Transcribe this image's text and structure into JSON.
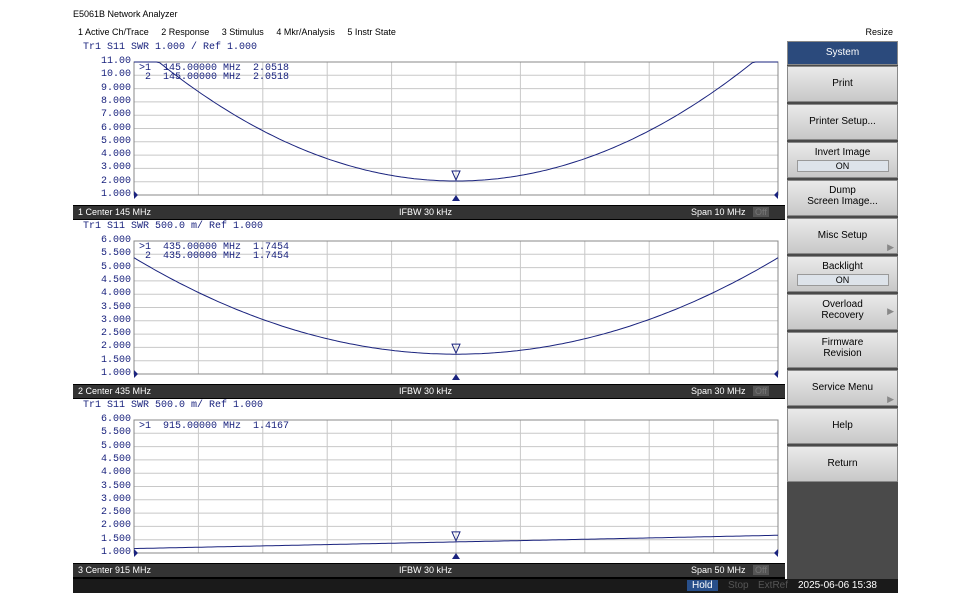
{
  "window": {
    "title": "E5061B Network Analyzer"
  },
  "menubar": {
    "items": [
      "1 Active Ch/Trace",
      "2 Response",
      "3 Stimulus",
      "4 Mkr/Analysis",
      "5 Instr State"
    ],
    "resize": "Resize"
  },
  "channels": [
    {
      "header": "Tr1 S11 SWR 1.000 / Ref 1.000",
      "trace_label": "Tr1",
      "yticks": [
        "11.00",
        "10.00",
        "9.000",
        "8.000",
        "7.000",
        "6.000",
        "5.000",
        "4.000",
        "3.000",
        "2.000",
        "1.000"
      ],
      "ymin": 1.0,
      "ymax": 11.0,
      "markers": [
        ">1  145.00000 MHz  2.0518",
        " 2  145.00000 MHz  2.0518"
      ],
      "status": {
        "center": "1 Center 145 MHz",
        "ifbw": "IFBW 30 kHz",
        "span": "Span 10 MHz",
        "off": "Off"
      },
      "curve": {
        "center_value": 2.0518,
        "center_x": 0.5,
        "k": 42.0,
        "clip": 11.0
      }
    },
    {
      "header": "Tr1 S11 SWR 500.0 m/ Ref 1.000",
      "trace_label": "Tr1",
      "yticks": [
        "6.000",
        "5.500",
        "5.000",
        "4.500",
        "4.000",
        "3.500",
        "3.000",
        "2.500",
        "2.000",
        "1.500",
        "1.000"
      ],
      "ymin": 1.0,
      "ymax": 6.0,
      "markers": [
        ">1  435.00000 MHz  1.7454",
        " 2  435.00000 MHz  1.7454"
      ],
      "status": {
        "center": "2 Center 435 MHz",
        "ifbw": "IFBW 30 kHz",
        "span": "Span 30 MHz",
        "off": "Off"
      },
      "curve": {
        "center_value": 1.7454,
        "center_x": 0.5,
        "k": 14.5,
        "clip": 6.0
      }
    },
    {
      "header": "Tr1 S11 SWR 500.0 m/ Ref 1.000",
      "trace_label": "Tr1",
      "yticks": [
        "6.000",
        "5.500",
        "5.000",
        "4.500",
        "4.000",
        "3.500",
        "3.000",
        "2.500",
        "2.000",
        "1.500",
        "1.000"
      ],
      "ymin": 1.0,
      "ymax": 6.0,
      "markers": [
        ">1  915.00000 MHz  1.4167"
      ],
      "status": {
        "center": "3 Center 915 MHz",
        "ifbw": "IFBW 30 kHz",
        "span": "Span 50 MHz",
        "off": "Off"
      },
      "curve": {
        "center_value": 1.4167,
        "center_x": 0.5,
        "k": 0.0,
        "slope": 0.5,
        "clip": 6.0
      }
    }
  ],
  "softkeys": {
    "header": "System",
    "print": "Print",
    "printer_setup": "Printer Setup...",
    "invert_image": "Invert Image",
    "invert_image_value": "ON",
    "dump_1": "Dump",
    "dump_2": "Screen Image...",
    "misc_setup": "Misc Setup",
    "backlight": "Backlight",
    "backlight_value": "ON",
    "overload_1": "Overload",
    "overload_2": "Recovery",
    "firmware_1": "Firmware",
    "firmware_2": "Revision",
    "service_menu": "Service Menu",
    "help": "Help",
    "return": "Return"
  },
  "statusbar": {
    "hold": "Hold",
    "stop": "Stop",
    "extref": "ExtRef",
    "datetime": "2025-06-06 15:38"
  },
  "colors": {
    "trace": "#1a237e",
    "grid": "#c8c8c8",
    "accent": "#2b4a7c"
  }
}
